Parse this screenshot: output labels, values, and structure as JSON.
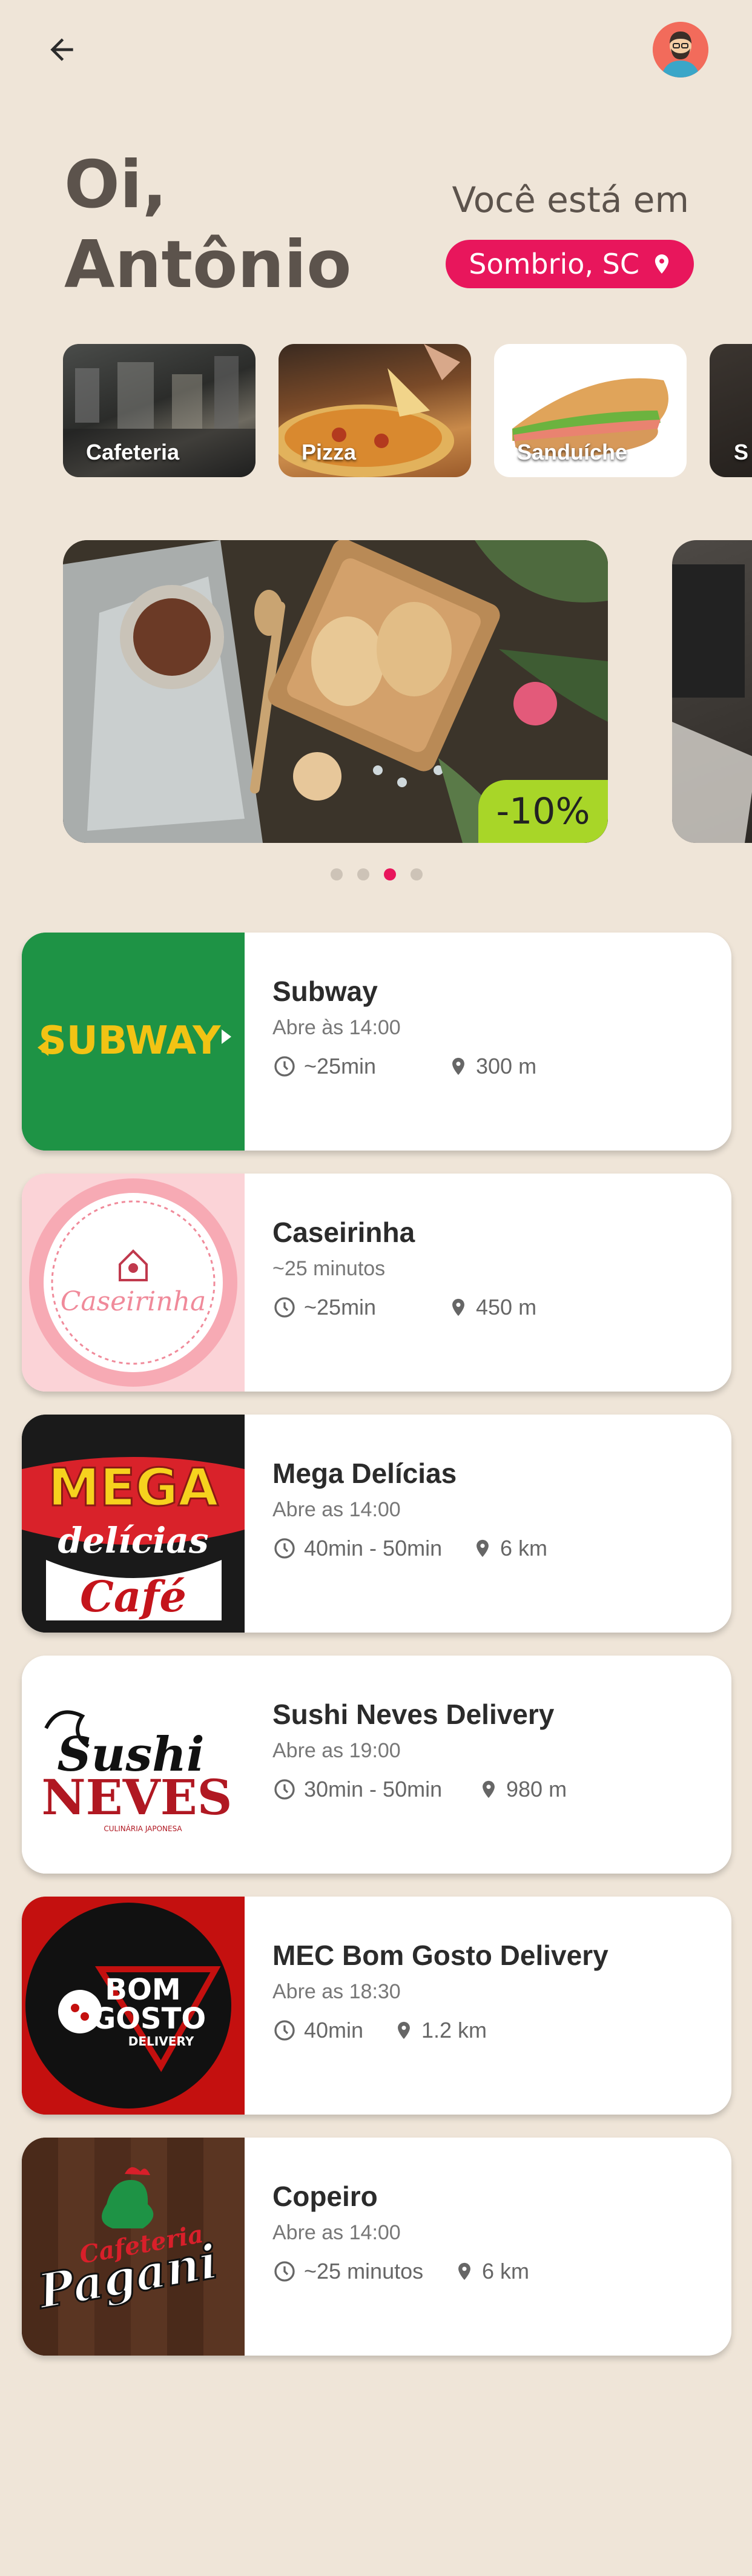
{
  "header": {
    "greeting_line1": "Oi,",
    "greeting_line2": "Antônio",
    "location_label": "Você está em",
    "location_value": "Sombrio, SC"
  },
  "categories": [
    {
      "label": "Cafeteria"
    },
    {
      "label": "Pizza"
    },
    {
      "label": "Sanduíche"
    },
    {
      "label": "S"
    }
  ],
  "banner": {
    "discount": "-10%"
  },
  "carousel": {
    "count": 4,
    "active_index": 2
  },
  "restaurants": [
    {
      "name": "Subway",
      "status": "Abre às 14:00",
      "time": "~25min",
      "distance": "300 m",
      "logo_text": "SUBWAY",
      "logo_bg": "#1e9345"
    },
    {
      "name": "Caseirinha",
      "status": "~25 minutos",
      "time": "~25min",
      "distance": "450 m",
      "logo_text": "Caseirinha",
      "logo_bg": "#fbd3d7"
    },
    {
      "name": "Mega Delícias",
      "status": "Abre as 14:00",
      "time": "40min - 50min",
      "distance": "6 km",
      "logo_text_1": "MEGA",
      "logo_text_2": "delícias",
      "logo_text_3": "Café",
      "logo_bg": "#1a1a1a"
    },
    {
      "name": "Sushi Neves Delivery",
      "status": "Abre as 19:00",
      "time": "30min - 50min",
      "distance": "980 m",
      "logo_text_1": "Sushi",
      "logo_text_2": "NEVES",
      "logo_text_3": "CULINÁRIA JAPONESA",
      "logo_bg": "#ffffff"
    },
    {
      "name": "MEC Bom Gosto Delivery",
      "status": "Abre as 18:30",
      "time": "40min",
      "distance": "1.2 km",
      "logo_text_1": "BOM",
      "logo_text_2": "GOSTO",
      "logo_text_3": "DELIVERY",
      "logo_bg": "#c4100f"
    },
    {
      "name": "Copeiro",
      "status": "Abre as 14:00",
      "time": "~25 minutos",
      "distance": "6 km",
      "logo_text_1": "Cafeteria",
      "logo_text_2": "Pagani",
      "logo_bg": "#5a3522"
    }
  ],
  "colors": {
    "accent": "#e8165c",
    "discount": "#a8d628",
    "background": "#efe5d8"
  },
  "icons": {
    "back": "arrow-left-icon",
    "location": "map-pin-icon",
    "time": "clock-icon",
    "distance": "map-pin-icon"
  }
}
